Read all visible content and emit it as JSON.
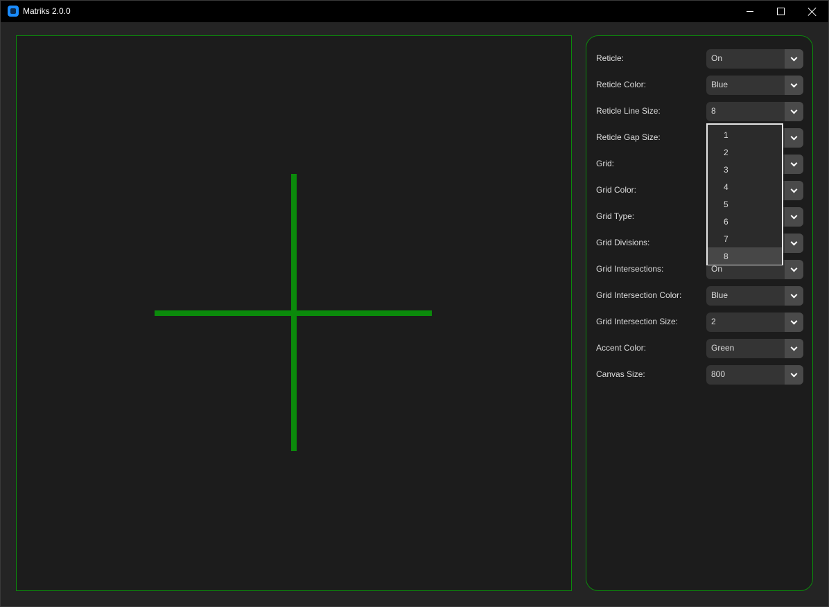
{
  "window": {
    "title": "Matriks 2.0.0"
  },
  "colors": {
    "accent": "#0b8a0b",
    "background": "#1c1c1c",
    "titlebar": "#000000"
  },
  "icons": {
    "app": "app-icon",
    "minimize": "minimize-icon",
    "maximize": "maximize-icon",
    "close": "close-icon",
    "dropdown": "chevron-down-icon"
  },
  "settings": [
    {
      "label": "Reticle:",
      "value": "On"
    },
    {
      "label": "Reticle Color:",
      "value": "Blue"
    },
    {
      "label": "Reticle Line Size:",
      "value": "8"
    },
    {
      "label": "Reticle Gap Size:",
      "value": ""
    },
    {
      "label": "Grid:",
      "value": ""
    },
    {
      "label": "Grid Color:",
      "value": ""
    },
    {
      "label": "Grid Type:",
      "value": ""
    },
    {
      "label": "Grid Divisions:",
      "value": ""
    },
    {
      "label": "Grid Intersections:",
      "value": "On"
    },
    {
      "label": "Grid Intersection Color:",
      "value": "Blue"
    },
    {
      "label": "Grid Intersection Size:",
      "value": "2"
    },
    {
      "label": "Accent Color:",
      "value": "Green"
    },
    {
      "label": "Canvas Size:",
      "value": "800"
    }
  ],
  "dropdown": {
    "open_for": "Reticle Line Size:",
    "options": [
      "1",
      "2",
      "3",
      "4",
      "5",
      "6",
      "7",
      "8"
    ],
    "selected": "8"
  }
}
